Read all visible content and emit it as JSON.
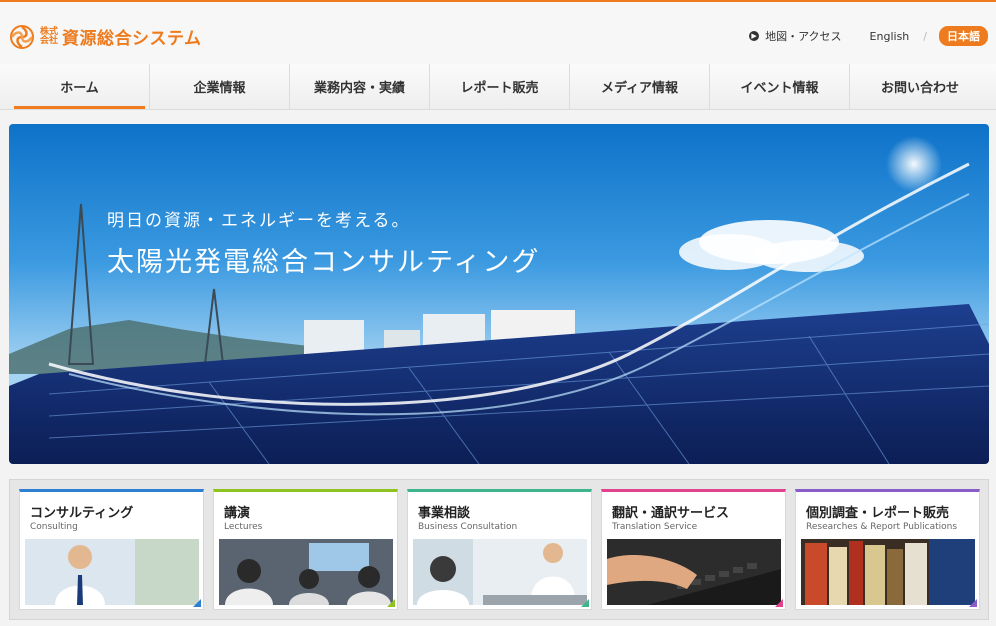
{
  "header": {
    "logo_sub": "株式会社",
    "logo_text": "資源総合システム",
    "access_label": "地図・アクセス",
    "english_label": "English",
    "japanese_label": "日本語"
  },
  "nav": {
    "items": [
      {
        "label": "ホーム"
      },
      {
        "label": "企業情報"
      },
      {
        "label": "業務内容・実績"
      },
      {
        "label": "レポート販売"
      },
      {
        "label": "メディア情報"
      },
      {
        "label": "イベント情報"
      },
      {
        "label": "お問い合わせ"
      }
    ]
  },
  "hero": {
    "tagline": "明日の資源・エネルギーを考える。",
    "headline": "太陽光発電総合コンサルティング"
  },
  "cards": [
    {
      "title": "コンサルティング",
      "subtitle": "Consulting",
      "accent": "#2d7fd3"
    },
    {
      "title": "講演",
      "subtitle": "Lectures",
      "accent": "#8dc21f"
    },
    {
      "title": "事業相談",
      "subtitle": "Business Consultation",
      "accent": "#3fb58c"
    },
    {
      "title": "翻訳・通訳サービス",
      "subtitle": "Translation Service",
      "accent": "#e0428e"
    },
    {
      "title": "個別調査・レポート販売",
      "subtitle": "Researches & Report Publications",
      "accent": "#8a5cc8"
    }
  ],
  "colors": {
    "brand": "#ee7b1d"
  }
}
